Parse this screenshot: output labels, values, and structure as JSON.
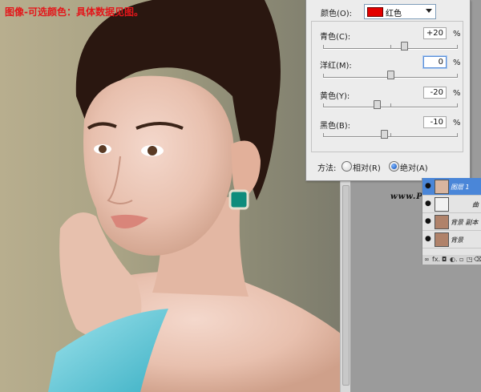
{
  "caption": "图像-可选颜色：具体数据见图。",
  "dialog": {
    "colors_label": "颜色(O):",
    "colors_value": "红色",
    "sliders": [
      {
        "label": "青色(C):",
        "value": "+20",
        "unit": "%",
        "level": 0.6
      },
      {
        "label": "洋红(M):",
        "value": "0",
        "unit": "%",
        "level": 0.5
      },
      {
        "label": "黄色(Y):",
        "value": "-20",
        "unit": "%",
        "level": 0.4
      },
      {
        "label": "黑色(B):",
        "value": "-10",
        "unit": "%",
        "level": 0.45
      }
    ],
    "method_label": "方法:",
    "method_relative": "相对(R)",
    "method_absolute": "绝对(A)",
    "method_selected": "absolute"
  },
  "watermark": "www.Psjia.com",
  "layers": [
    {
      "name": "图层 1",
      "selected": true
    },
    {
      "name": "曲",
      "selected": false
    },
    {
      "name": "背景 副本",
      "selected": false
    },
    {
      "name": "背景",
      "selected": false
    }
  ],
  "layers_footer": [
    "∞",
    "fx.",
    "◘",
    "◐.",
    "▫",
    "◳",
    "⌫"
  ],
  "colors": {
    "caption": "#e3161a",
    "swatch_red": "#e30000",
    "selected_layer": "#4a86d8"
  }
}
